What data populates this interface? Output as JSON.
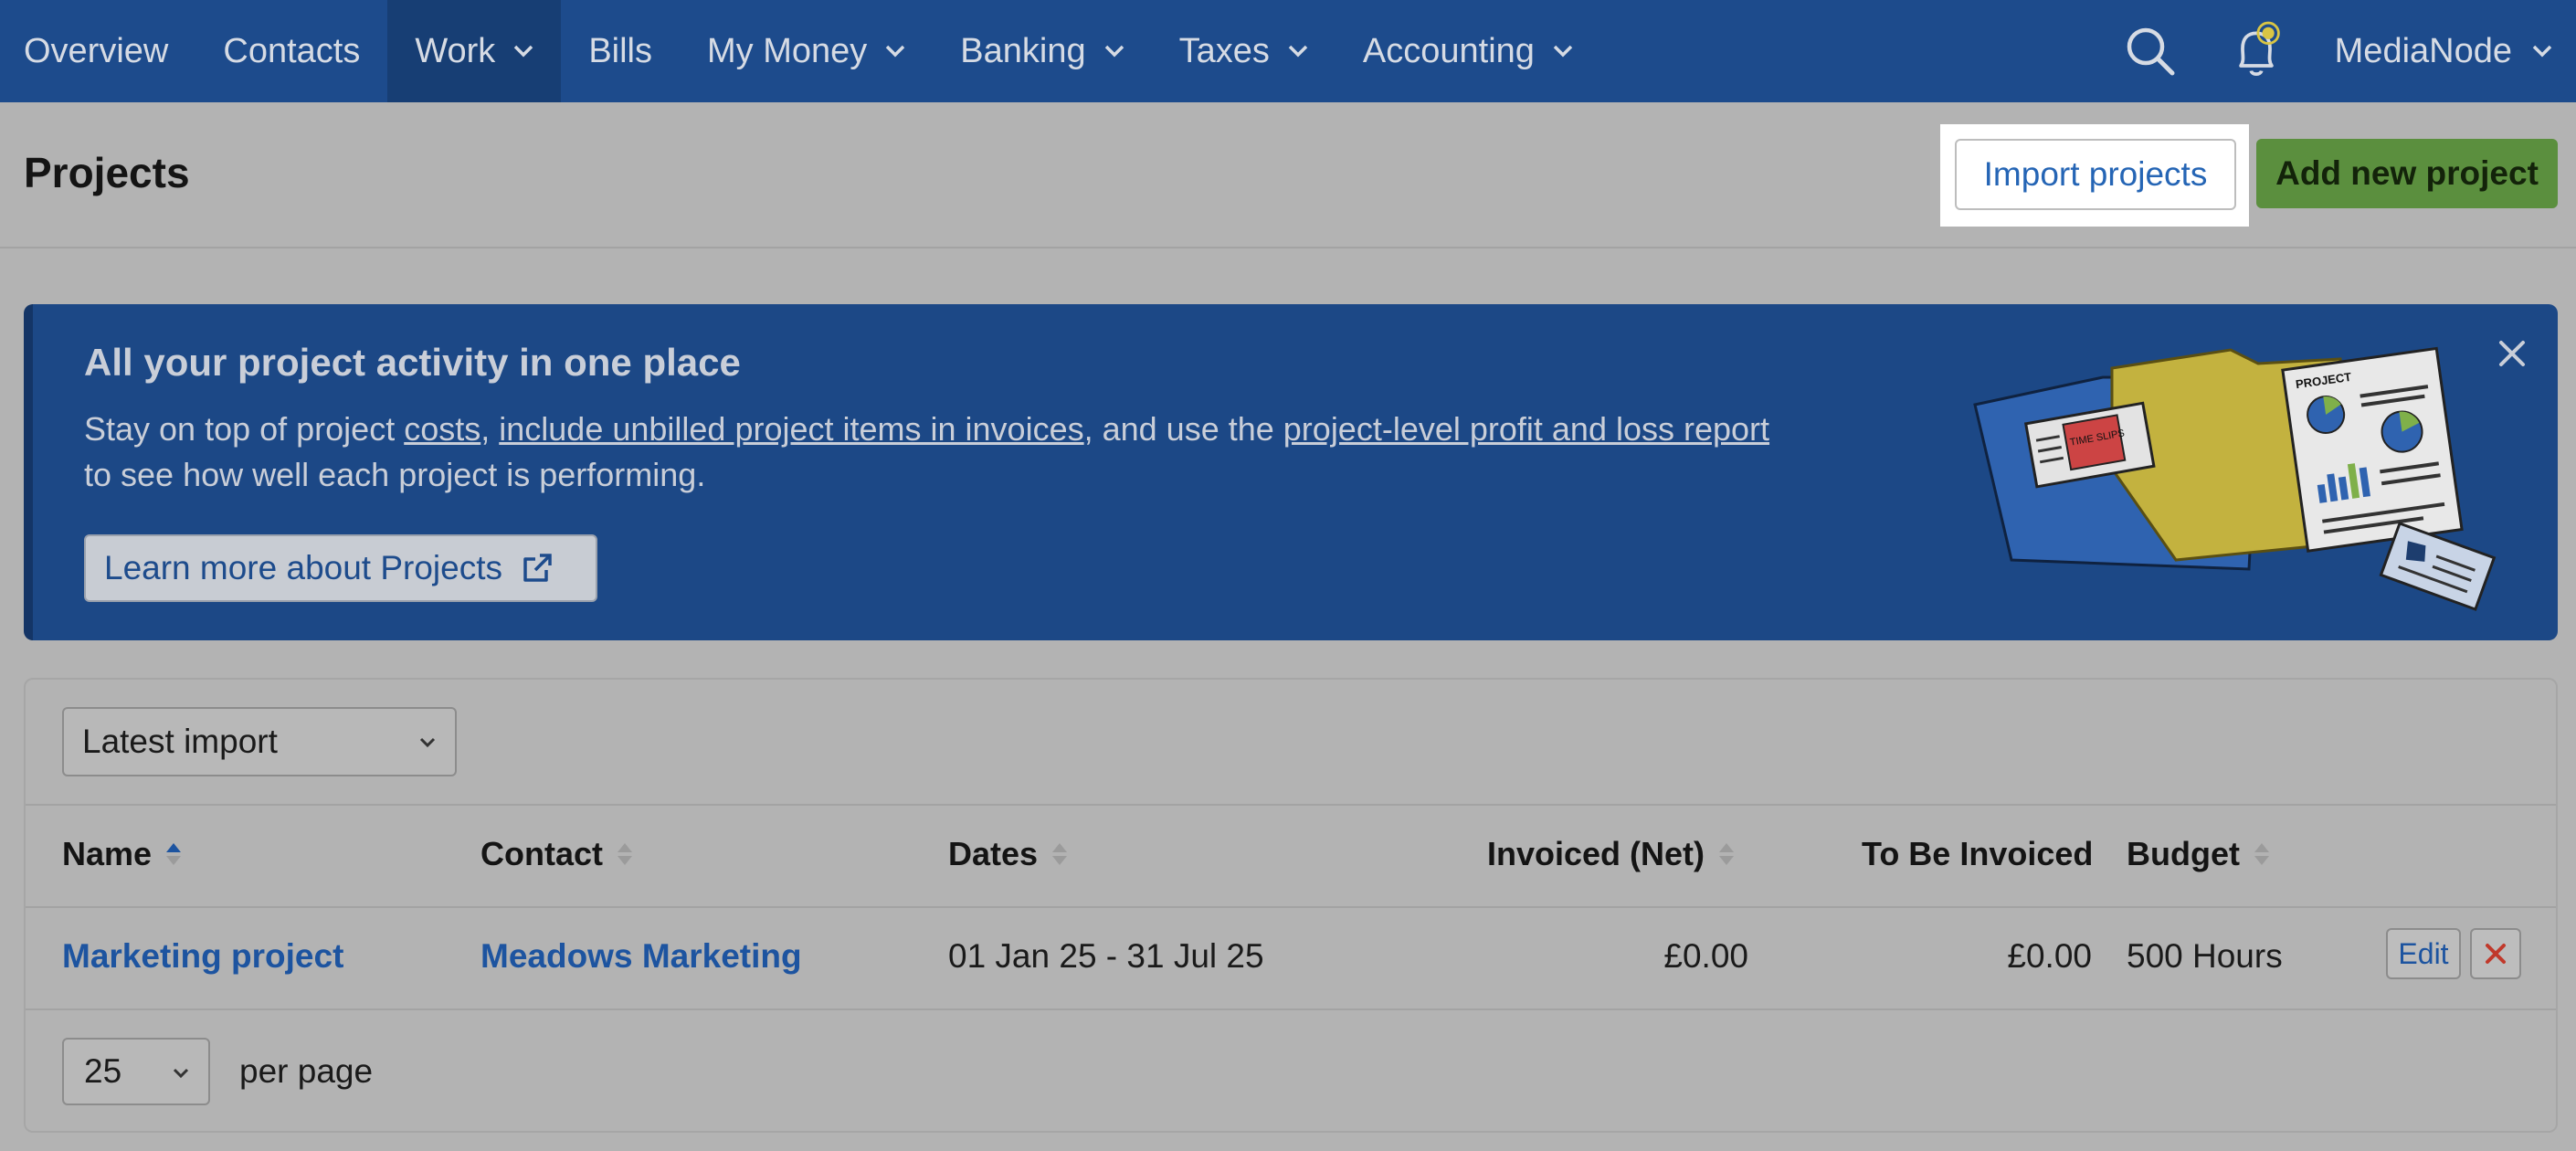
{
  "nav": {
    "items": [
      {
        "label": "Overview",
        "dropdown": false
      },
      {
        "label": "Contacts",
        "dropdown": false
      },
      {
        "label": "Work",
        "dropdown": true,
        "active": true
      },
      {
        "label": "Bills",
        "dropdown": false
      },
      {
        "label": "My Money",
        "dropdown": true
      },
      {
        "label": "Banking",
        "dropdown": true
      },
      {
        "label": "Taxes",
        "dropdown": true
      },
      {
        "label": "Accounting",
        "dropdown": true
      }
    ],
    "search_icon": "search-icon",
    "notifications_icon": "bell-icon",
    "account_label": "MediaNode"
  },
  "header": {
    "title": "Projects",
    "import_label": "Import projects",
    "add_label": "Add new project"
  },
  "banner": {
    "heading": "All your project activity in one place",
    "text_1": "Stay on top of project ",
    "link_costs": "costs",
    "text_2": ", ",
    "link_invoices": "include unbilled project items in invoices",
    "text_3": ", and use the ",
    "link_report": "project-level profit and loss report",
    "text_4": " to see how well each project is performing.",
    "learn_label": "Learn more about Projects",
    "illustration_project_label": "PROJECT",
    "illustration_time_label": "TIME SLIPS"
  },
  "table": {
    "filter_value": "Latest import",
    "columns": {
      "name": "Name",
      "contact": "Contact",
      "dates": "Dates",
      "invoiced": "Invoiced (Net)",
      "to_be_invoiced": "To Be Invoiced",
      "budget": "Budget"
    },
    "rows": [
      {
        "name": "Marketing project",
        "contact": "Meadows Marketing",
        "dates": "01 Jan 25 - 31 Jul 25",
        "invoiced": "£0.00",
        "to_be_invoiced": "£0.00",
        "budget": "500 Hours",
        "edit_label": "Edit"
      }
    ],
    "per_page_value": "25",
    "per_page_label": "per page"
  },
  "colors": {
    "nav_bg": "#1d4b8c",
    "banner_bg": "#1c4886",
    "add_button": "#5b8f3e",
    "link": "#1d54a0",
    "delete": "#c0392b"
  }
}
